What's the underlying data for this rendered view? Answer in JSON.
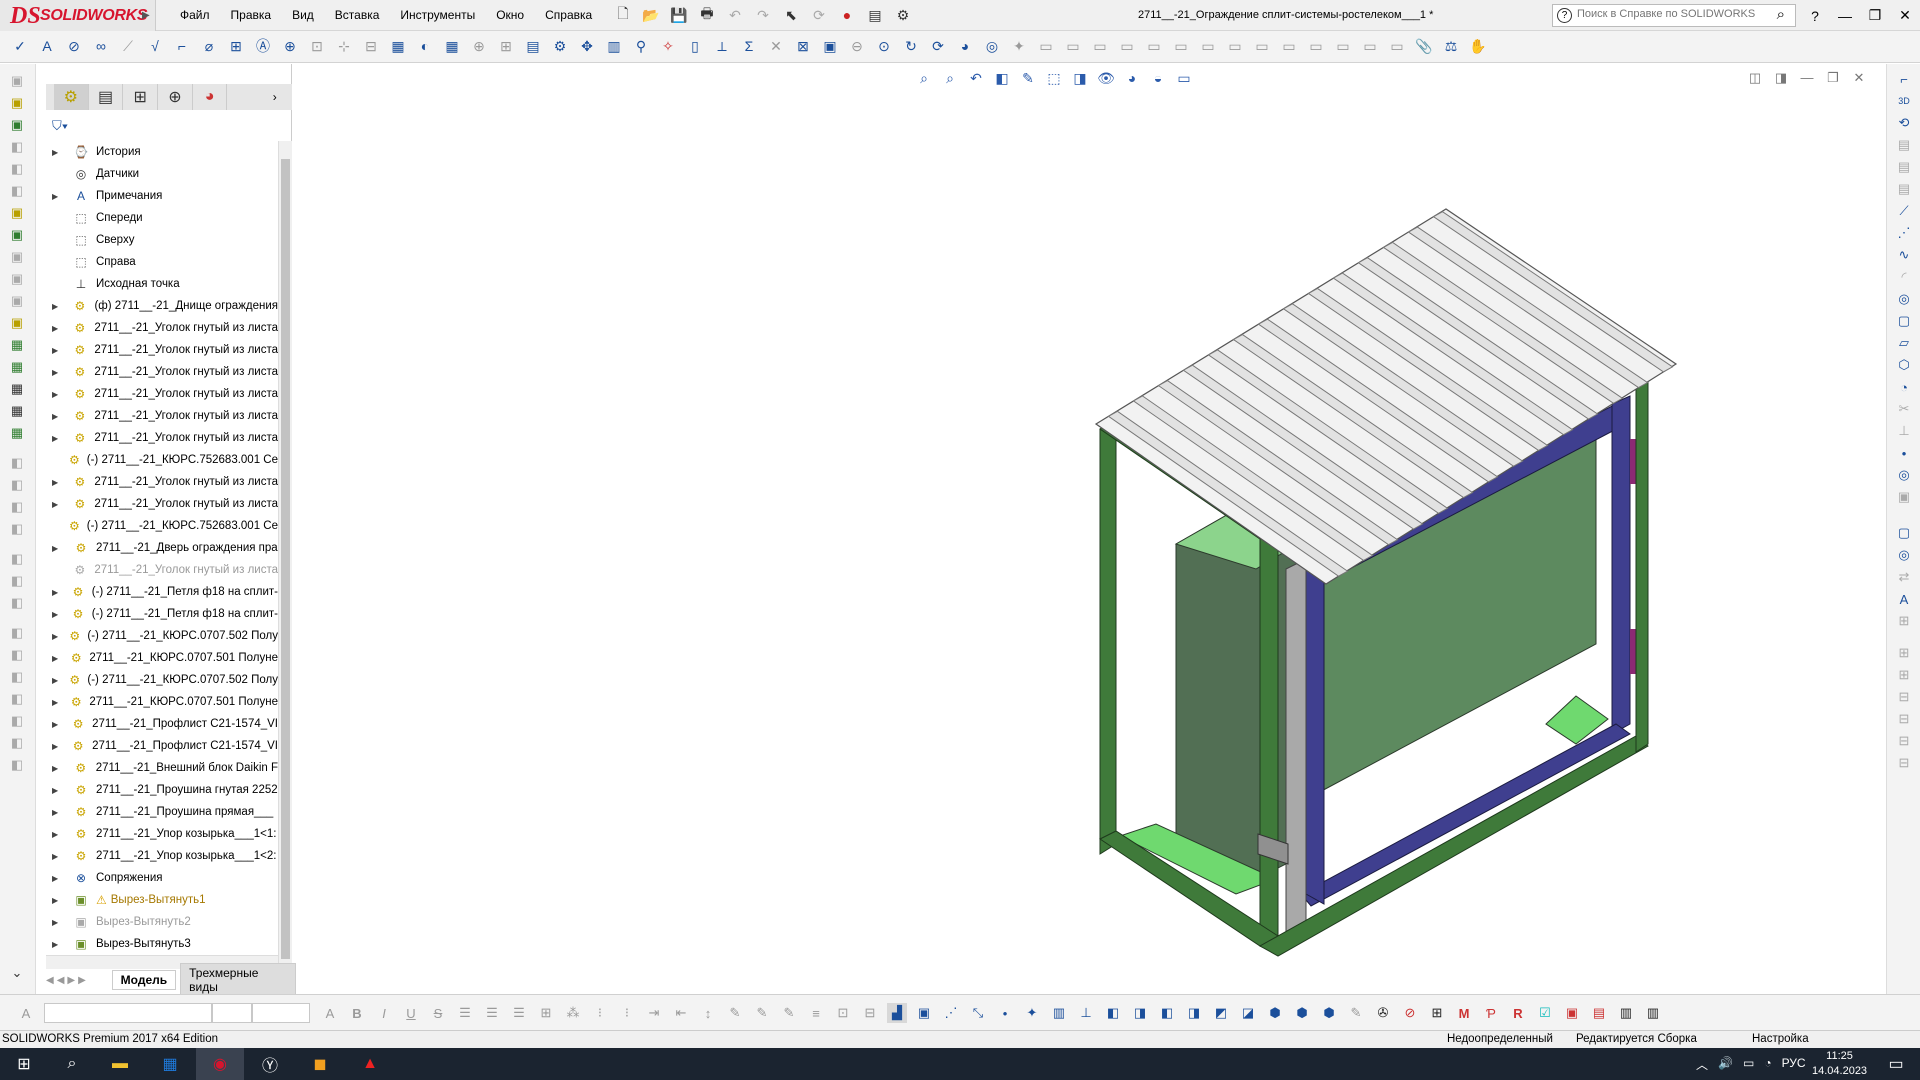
{
  "app": {
    "brand": "SOLIDWORKS",
    "document_title": "2711__-21_Ограждение сплит-системы-ростелеком___1 *"
  },
  "menu": [
    "Файл",
    "Правка",
    "Вид",
    "Вставка",
    "Инструменты",
    "Окно",
    "Справка"
  ],
  "help_search": {
    "placeholder": "Поиск в Справке по SOLIDWORKS"
  },
  "feature_tree": {
    "items": [
      {
        "label": "История",
        "icon": "history-icon",
        "expand": true
      },
      {
        "label": "Датчики",
        "icon": "sensors-icon",
        "expand": false
      },
      {
        "label": "Примечания",
        "icon": "annotations-icon",
        "expand": true
      },
      {
        "label": "Спереди",
        "icon": "plane-icon",
        "expand": false
      },
      {
        "label": "Сверху",
        "icon": "plane-icon",
        "expand": false
      },
      {
        "label": "Справа",
        "icon": "plane-icon",
        "expand": false
      },
      {
        "label": "Исходная точка",
        "icon": "origin-icon",
        "expand": false
      },
      {
        "label": "(ф) 2711__-21_Днище ограждения",
        "icon": "part-icon",
        "expand": true
      },
      {
        "label": "2711__-21_Уголок гнутый из листа",
        "icon": "part-icon",
        "expand": true
      },
      {
        "label": "2711__-21_Уголок гнутый из листа",
        "icon": "part-icon",
        "expand": true
      },
      {
        "label": "2711__-21_Уголок гнутый из листа",
        "icon": "part-icon",
        "expand": true
      },
      {
        "label": "2711__-21_Уголок гнутый из листа",
        "icon": "part-icon",
        "expand": true
      },
      {
        "label": "2711__-21_Уголок гнутый из листа",
        "icon": "part-icon",
        "expand": true
      },
      {
        "label": "2711__-21_Уголок гнутый из листа",
        "icon": "part-icon",
        "expand": true
      },
      {
        "label": "(-) 2711__-21_КЮРС.752683.001 Се",
        "icon": "part-icon",
        "expand": false
      },
      {
        "label": "2711__-21_Уголок гнутый из листа",
        "icon": "part-icon",
        "expand": true
      },
      {
        "label": "2711__-21_Уголок гнутый из листа",
        "icon": "part-icon",
        "expand": true
      },
      {
        "label": "(-) 2711__-21_КЮРС.752683.001 Се",
        "icon": "part-icon",
        "expand": false
      },
      {
        "label": "2711__-21_Дверь ограждения пра",
        "icon": "part-icon",
        "expand": true
      },
      {
        "label": "2711__-21_Уголок гнутый из листа",
        "icon": "part-icon",
        "expand": false,
        "gray": true
      },
      {
        "label": "(-) 2711__-21_Петля ф18 на сплит-",
        "icon": "part-icon",
        "expand": true
      },
      {
        "label": "(-) 2711__-21_Петля ф18 на сплит-",
        "icon": "part-icon",
        "expand": true
      },
      {
        "label": "(-) 2711__-21_КЮРС.0707.502 Полу",
        "icon": "part-icon",
        "expand": true
      },
      {
        "label": "2711__-21_КЮРС.0707.501 Полуне",
        "icon": "part-icon",
        "expand": true
      },
      {
        "label": "(-) 2711__-21_КЮРС.0707.502 Полу",
        "icon": "part-icon",
        "expand": true
      },
      {
        "label": "2711__-21_КЮРС.0707.501 Полуне",
        "icon": "part-icon",
        "expand": true
      },
      {
        "label": "2711__-21_Профлист С21-1574_VI",
        "icon": "part-icon",
        "expand": true
      },
      {
        "label": "2711__-21_Профлист С21-1574_VI",
        "icon": "part-icon",
        "expand": true
      },
      {
        "label": "2711__-21_Внешний блок Daikin F",
        "icon": "part-icon",
        "expand": true
      },
      {
        "label": "2711__-21_Проушина гнутая 2252",
        "icon": "part-icon",
        "expand": true
      },
      {
        "label": "2711__-21_Проушина прямая___",
        "icon": "part-icon",
        "expand": true
      },
      {
        "label": "2711__-21_Упор козырька___1<1:",
        "icon": "part-icon",
        "expand": true
      },
      {
        "label": "2711__-21_Упор козырька___1<2:",
        "icon": "part-icon",
        "expand": true
      },
      {
        "label": "Сопряжения",
        "icon": "mates-icon",
        "expand": true
      },
      {
        "label": "Вырез-Вытянуть1",
        "icon": "cut-extrude-icon",
        "expand": true,
        "warn": true
      },
      {
        "label": "Вырез-Вытянуть2",
        "icon": "cut-extrude-icon",
        "expand": true,
        "gray": true
      },
      {
        "label": "Вырез-Вытянуть3",
        "icon": "cut-extrude-icon",
        "expand": true
      }
    ]
  },
  "bottom_tabs": {
    "model": "Модель",
    "views3d": "Трехмерные виды"
  },
  "status": {
    "edition": "SOLIDWORKS Premium 2017 x64 Edition",
    "defined": "Недоопределенный",
    "editing": "Редактируется Сборка",
    "custom": "Настройка"
  },
  "taskbar": {
    "lang": "РУС",
    "time": "11:25",
    "date": "14.04.2023"
  },
  "colors": {
    "frame_green": "#3f7a3a",
    "frame_blue": "#3f3f8f",
    "panel_green": "#5d8a5f",
    "roof": "#f2f2f2",
    "accent_red": "#d7152e"
  }
}
